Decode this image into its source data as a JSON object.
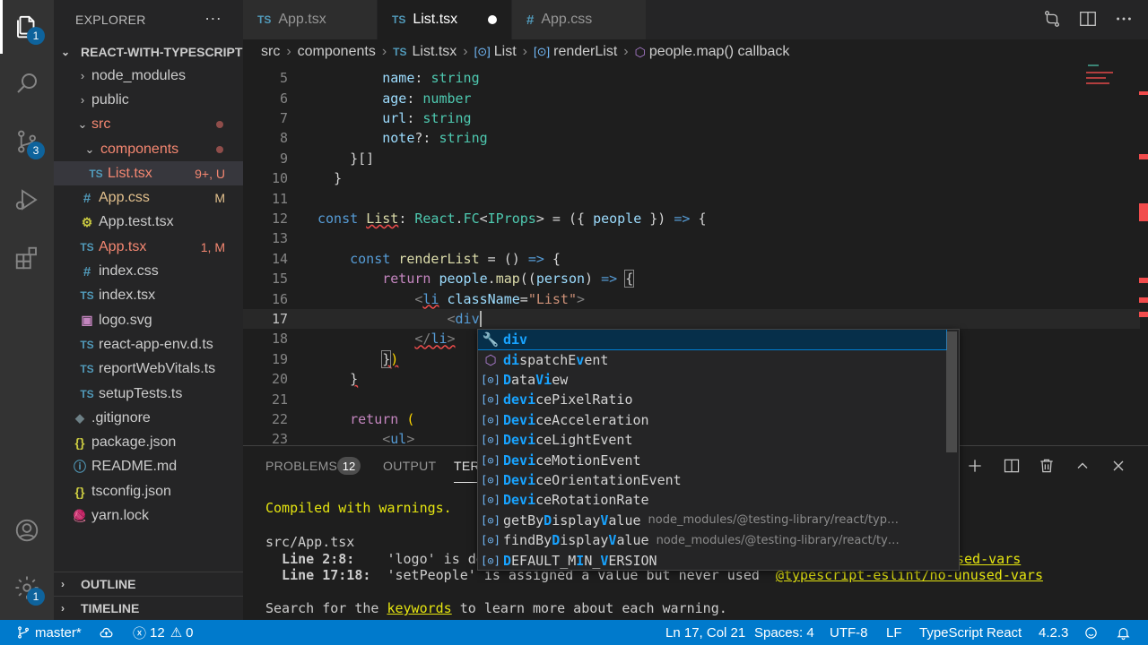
{
  "activity_bar": {
    "explorer_badge": "1",
    "scm_badge": "3",
    "settings_badge": "1"
  },
  "sidebar": {
    "title": "EXPLORER",
    "more": "···",
    "project": "REACT-WITH-TYPESCRIPT",
    "items": [
      {
        "label": "node_modules",
        "kind": "folder"
      },
      {
        "label": "public",
        "kind": "folder"
      },
      {
        "label": "src",
        "kind": "folder-open"
      },
      {
        "label": "components",
        "kind": "folder-open"
      },
      {
        "label": "List.tsx",
        "icon": "TS",
        "status": "9+, U"
      },
      {
        "label": "App.css",
        "icon": "#",
        "status": "M"
      },
      {
        "label": "App.test.tsx",
        "icon": "⚙"
      },
      {
        "label": "App.tsx",
        "icon": "TS",
        "status": "1, M"
      },
      {
        "label": "index.css",
        "icon": "#"
      },
      {
        "label": "index.tsx",
        "icon": "TS"
      },
      {
        "label": "logo.svg",
        "icon": "▣"
      },
      {
        "label": "react-app-env.d.ts",
        "icon": "TS"
      },
      {
        "label": "reportWebVitals.ts",
        "icon": "TS"
      },
      {
        "label": "setupTests.ts",
        "icon": "TS"
      },
      {
        "label": ".gitignore",
        "icon": "◆"
      },
      {
        "label": "package.json",
        "icon": "{}"
      },
      {
        "label": "README.md",
        "icon": "ⓘ"
      },
      {
        "label": "tsconfig.json",
        "icon": "{}"
      },
      {
        "label": "yarn.lock",
        "icon": "🧶"
      }
    ],
    "outline": "OUTLINE",
    "timeline": "TIMELINE"
  },
  "tabs": [
    {
      "icon": "TS",
      "label": "App.tsx"
    },
    {
      "icon": "TS",
      "label": "List.tsx"
    },
    {
      "icon": "#",
      "label": "App.css"
    }
  ],
  "breadcrumb": [
    "src",
    "components",
    "List.tsx",
    "List",
    "renderList",
    "people.map() callback"
  ],
  "editor": {
    "line_numbers": [
      "5",
      "6",
      "7",
      "8",
      "9",
      "10",
      "11",
      "12",
      "13",
      "14",
      "15",
      "16",
      "17",
      "18",
      "19",
      "20",
      "21",
      "22",
      "23"
    ]
  },
  "suggest": [
    {
      "pre": "",
      "hl": "div",
      "post": "",
      "detail": ""
    },
    {
      "pre": "",
      "hl": "di",
      "post": "spatchE",
      "hl2": "v",
      "post2": "ent",
      "detail": ""
    },
    {
      "pre": "",
      "hl": "D",
      "post": "ata",
      "hl2": "Vi",
      "post2": "ew",
      "detail": ""
    },
    {
      "pre": "",
      "hl": "devi",
      "post": "cePixelRatio",
      "detail": ""
    },
    {
      "pre": "",
      "hl": "Devi",
      "post": "ceAcceleration",
      "detail": ""
    },
    {
      "pre": "",
      "hl": "Devi",
      "post": "ceLightEvent",
      "detail": ""
    },
    {
      "pre": "",
      "hl": "Devi",
      "post": "ceMotionEvent",
      "detail": ""
    },
    {
      "pre": "",
      "hl": "Devi",
      "post": "ceOrientationEvent",
      "detail": ""
    },
    {
      "pre": "",
      "hl": "Devi",
      "post": "ceRotationRate",
      "detail": ""
    },
    {
      "pre": "getBy",
      "hl": "D",
      "post": "isplay",
      "hl2": "V",
      "post2": "alue",
      "detail": "node_modules/@testing-library/react/typ…"
    },
    {
      "pre": "findBy",
      "hl": "D",
      "post": "isplay",
      "hl2": "V",
      "post2": "alue",
      "detail": "node_modules/@testing-library/react/ty…"
    },
    {
      "pre": "",
      "hl": "D",
      "post": "EFAULT_M",
      "hl2": "I",
      "post2": "N_",
      "hl3": "V",
      "post3": "ERSION",
      "detail": ""
    }
  ],
  "panel": {
    "tabs": [
      "PROBLEMS",
      "OUTPUT",
      "TERMINAL"
    ],
    "problems_count": "12",
    "terminal": {
      "line1": "Compiled with warnings.",
      "line2": "src/App.tsx",
      "line3a": "  Line 2:8:",
      "line3b": "    'logo' is de",
      "line3c": "sed-vars",
      "line4a": "  Line 17:18:",
      "line4b": "  'setPeople' is assigned a value but never used",
      "line4c": "@typescript-eslint/no-unused-vars",
      "line5a": "Search for the ",
      "line5b": "keywords",
      "line5c": " to learn more about each warning."
    }
  },
  "status": {
    "branch": "master*",
    "errors": "12",
    "warnings": "0",
    "position": "Ln 17, Col 21",
    "spaces": "Spaces: 4",
    "encoding": "UTF-8",
    "eol": "LF",
    "language": "TypeScript React",
    "version": "4.2.3"
  },
  "colors": {
    "accent": "#007acc",
    "ts_icon": "#519aba",
    "modified": "#e2c08d",
    "untracked": "#73c991"
  }
}
